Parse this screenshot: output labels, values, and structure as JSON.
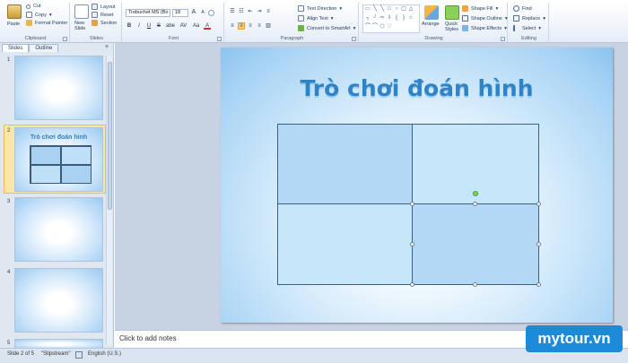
{
  "ribbon": {
    "clipboard": {
      "paste": "Paste",
      "cut": "Cut",
      "copy": "Copy",
      "format_painter": "Format Painter",
      "label": "Clipboard"
    },
    "slides": {
      "new_slide_line1": "New",
      "new_slide_line2": "Slide",
      "layout": "Layout",
      "reset": "Reset",
      "section": "Section",
      "label": "Slides"
    },
    "font": {
      "name": "Trebuchet MS (Bo",
      "size": "18",
      "grow": "A",
      "shrink": "A",
      "bold": "B",
      "italic": "I",
      "underline": "U",
      "strike": "S",
      "shadow": "abe",
      "spacing": "AV",
      "case": "Aa",
      "color": "A",
      "label": "Font"
    },
    "paragraph": {
      "text_direction": "Text Direction",
      "align_text": "Align Text",
      "convert_smartart": "Convert to SmartArt",
      "label": "Paragraph"
    },
    "drawing": {
      "arrange": "Arrange",
      "quick_styles_line1": "Quick",
      "quick_styles_line2": "Styles",
      "shape_fill": "Shape Fill",
      "shape_outline": "Shape Outline",
      "shape_effects": "Shape Effects",
      "label": "Drawing"
    },
    "editing": {
      "find": "Find",
      "replace": "Replace",
      "select": "Select",
      "label": "Editing"
    }
  },
  "left_pane": {
    "tabs": [
      "Slides",
      "Outline"
    ],
    "close": "×",
    "thumbnails": [
      {
        "number": "1",
        "title": ""
      },
      {
        "number": "2",
        "title": "Trò chơi đoán hình"
      },
      {
        "number": "3",
        "title": ""
      },
      {
        "number": "4",
        "title": ""
      },
      {
        "number": "5",
        "title": ""
      }
    ]
  },
  "slide": {
    "title": "Trò chơi đoán hình",
    "cells": [
      {
        "name": "top-left",
        "color": "#b3d8f5"
      },
      {
        "name": "top-right",
        "color": "#c6e6f9"
      },
      {
        "name": "bottom-left",
        "color": "#c6e6f9"
      },
      {
        "name": "bottom-right",
        "color": "#b3d8f5"
      }
    ]
  },
  "notes": {
    "placeholder": "Click to add notes"
  },
  "status": {
    "slide_info": "Slide 2 of 5",
    "theme": "\"Slipstream\"",
    "language": "English (U.S.)"
  },
  "watermark": {
    "text": "mytour.vn"
  },
  "colors": {
    "accent": "#2f84c8",
    "watermark_bg": "#1d8ad8"
  }
}
